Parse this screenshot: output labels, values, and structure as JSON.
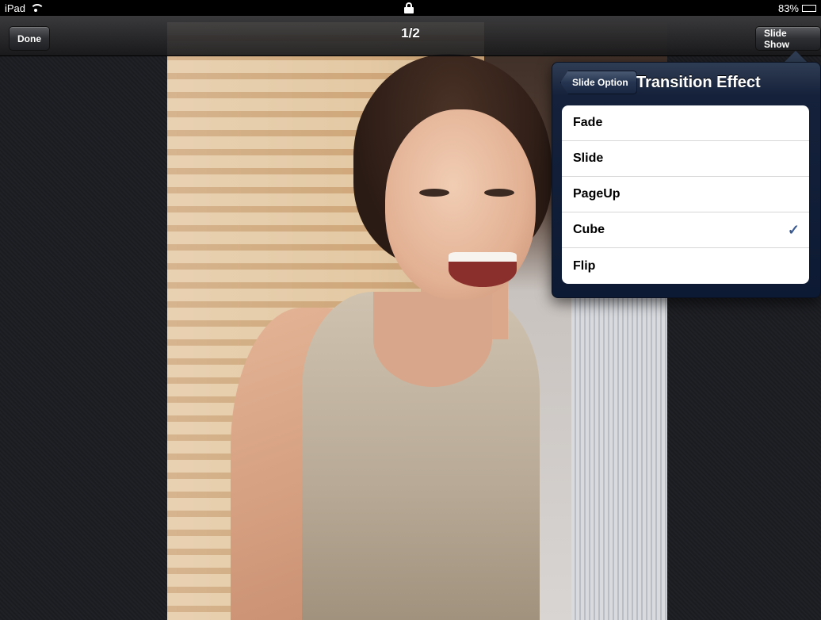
{
  "status_bar": {
    "device": "iPad",
    "battery": "83%",
    "battery_level": 0.83,
    "wifi_icon": "wifi-icon",
    "lock_icon": "lock-icon",
    "battery_icon": "battery-icon"
  },
  "nav_bar": {
    "done_label": "Done",
    "title": "1/2",
    "slideshow_label": "Slide Show"
  },
  "popover": {
    "back_label": "Slide Option",
    "title": "Transition Effect",
    "options": [
      {
        "label": "Fade",
        "checked": false
      },
      {
        "label": "Slide",
        "checked": false
      },
      {
        "label": "PageUp",
        "checked": false
      },
      {
        "label": "Cube",
        "checked": true
      },
      {
        "label": "Flip",
        "checked": false
      }
    ],
    "check_mark": "✓",
    "accent": "#3a5a92"
  }
}
